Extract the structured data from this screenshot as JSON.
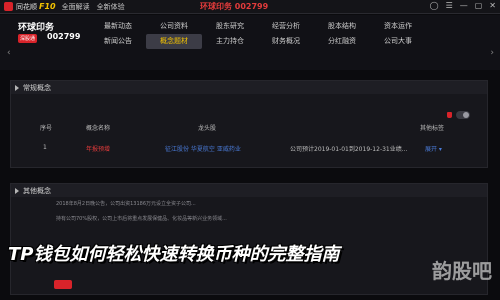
{
  "app": {
    "logo_text": "同花顺",
    "logo_product": "F10",
    "menu": [
      "全面解读",
      "全新体验"
    ],
    "window_title": "环球印务 002799",
    "controls": [
      "◯",
      "☰",
      "—",
      "▢",
      "✕"
    ]
  },
  "stock": {
    "name": "环球印务",
    "tag": "深股通",
    "code": "002799"
  },
  "nav": [
    {
      "label": "最新动态",
      "active": false
    },
    {
      "label": "公司资料",
      "active": false
    },
    {
      "label": "股东研究",
      "active": false
    },
    {
      "label": "经营分析",
      "active": false
    },
    {
      "label": "股本结构",
      "active": false
    },
    {
      "label": "资本运作",
      "active": false
    },
    {
      "label": "新闻公告",
      "active": false
    },
    {
      "label": "概念题材",
      "active": true
    },
    {
      "label": "主力持仓",
      "active": false
    },
    {
      "label": "财务概况",
      "active": false
    },
    {
      "label": "分红融资",
      "active": false
    },
    {
      "label": "公司大事",
      "active": false
    }
  ],
  "panels": {
    "regular": {
      "title": "常规概念"
    },
    "other": {
      "title": "其他概念"
    }
  },
  "table": {
    "headers": [
      "序号",
      "概念名称",
      "龙头股",
      "",
      "",
      "其他标签"
    ],
    "rows": [
      {
        "index": "1",
        "concept": "年报预增",
        "stocks": "征江股份  华夏航空  亚威药业",
        "report": "公司预计2019-01-01到2019-12-31业绩...",
        "action": "展开 ▾"
      }
    ]
  },
  "lower_rows": [
    "2018年8月2日晚公告，公司出资13186万元设立全资子公司...",
    "持有公司70%股权，公司上市后将重点发展保健品、化妆品等新兴业务领域..."
  ],
  "overlay": {
    "headline": "TP钱包如何轻松快速转换币种的完整指南"
  },
  "watermark": {
    "text": "韵股吧"
  }
}
